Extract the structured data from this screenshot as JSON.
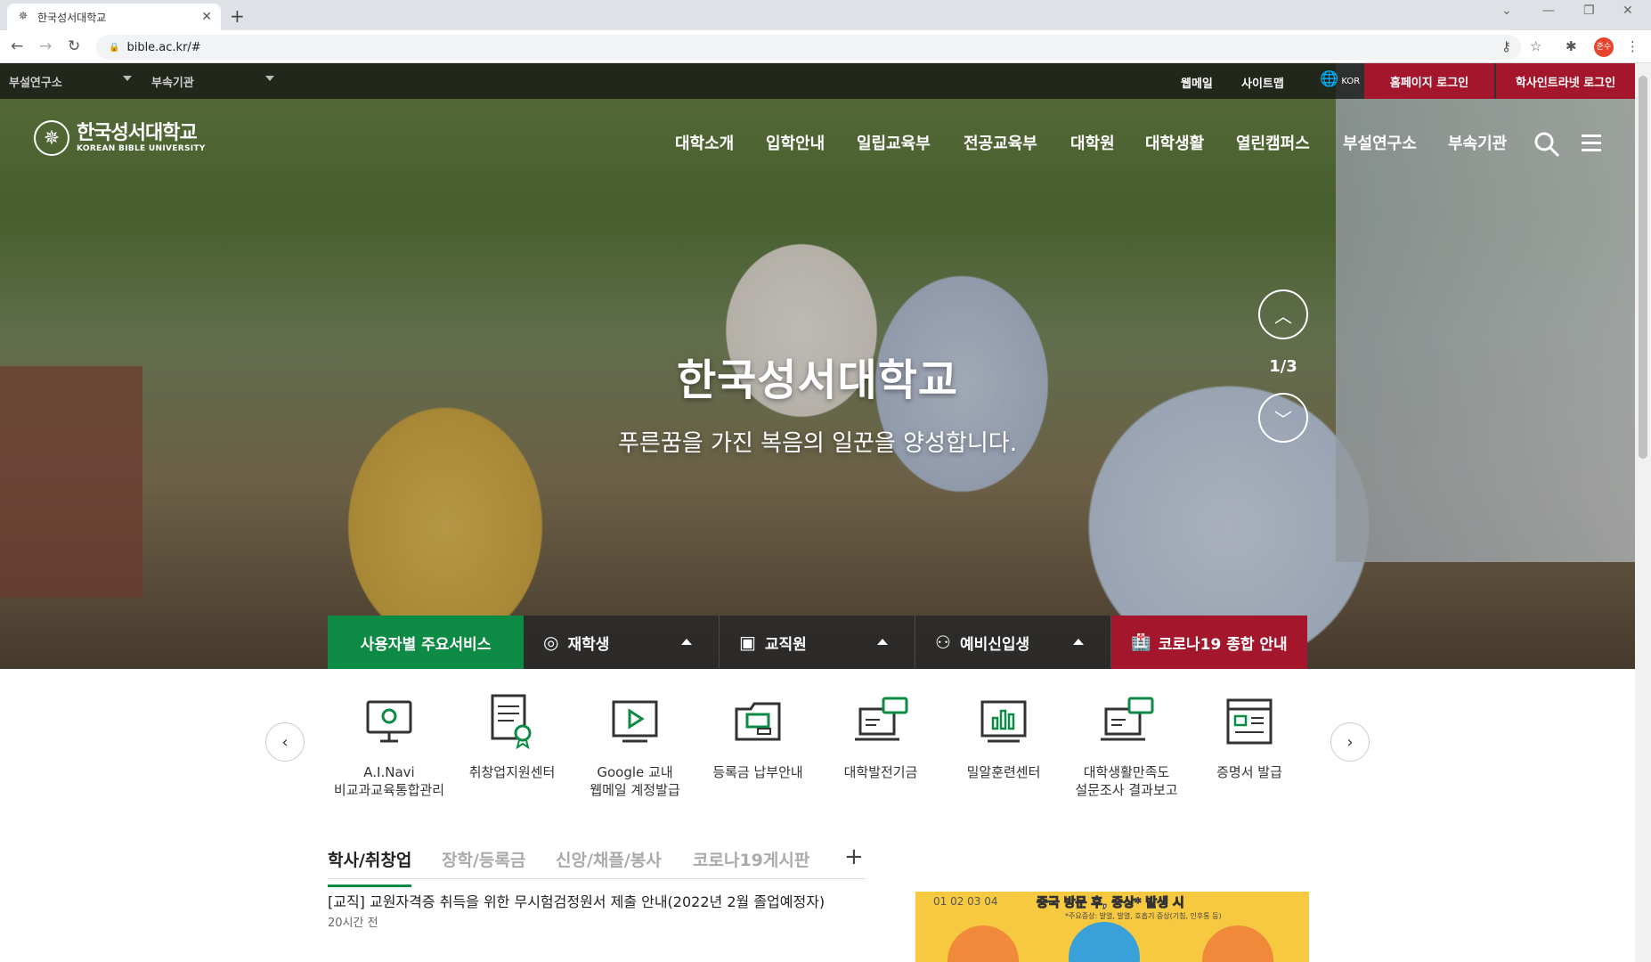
{
  "browser": {
    "tab_title": "한국성서대학교",
    "url": "bible.ac.kr/#",
    "profile_label": "준수"
  },
  "util": {
    "dropdowns": [
      "부설연구소",
      "부속기관"
    ],
    "links": [
      "웹메일",
      "사이트맵"
    ],
    "lang": "KOR",
    "login_home": "홈페이지 로그인",
    "login_intranet": "학사인트라넷 로그인"
  },
  "logo": {
    "ko": "한국성서대학교",
    "en": "KOREAN BIBLE UNIVERSITY"
  },
  "gnb": [
    "대학소개",
    "입학안내",
    "일립교육부",
    "전공교육부",
    "대학원",
    "대학생활",
    "열린캠퍼스",
    "부설연구소",
    "부속기관"
  ],
  "hero": {
    "title": "한국성서대학교",
    "subtitle": "푸른꿈을 가진 복음의 일꾼을 양성합니다.",
    "slide_counter": "1/3"
  },
  "services": {
    "head": "사용자별 주요서비스",
    "student": "재학생",
    "staff": "교직원",
    "freshman": "예비신입생",
    "covid": "코로나19 종합 안내"
  },
  "quicklinks": [
    {
      "label": "A.I.Navi\n비교과교육통합관리",
      "icon": "monitor-gear-icon"
    },
    {
      "label": "취창업지원센터",
      "icon": "certificate-icon"
    },
    {
      "label": "Google 교내\n웹메일 계정발급",
      "icon": "video-screen-icon"
    },
    {
      "label": "등록금 납부안내",
      "icon": "folder-icon"
    },
    {
      "label": "대학발전기금",
      "icon": "laptop-chat-icon"
    },
    {
      "label": "밀알훈련센터",
      "icon": "chart-monitor-icon"
    },
    {
      "label": "대학생활만족도\n설문조사 결과보고",
      "icon": "laptop-chat-icon"
    },
    {
      "label": "증명서 발급",
      "icon": "document-icon"
    }
  ],
  "news": {
    "tabs": [
      "학사/취창업",
      "장학/등록금",
      "신앙/채플/봉사",
      "코로나19게시판"
    ],
    "items": [
      {
        "title": "[교직] 교원자격증 취득을 위한 무시험검정원서 제출 안내(2022년 2월 졸업예정자)",
        "time": "20시간 전"
      }
    ]
  },
  "banner": {
    "nums": "01   02   03   04",
    "title": "중국 방문 후, 증상* 발생 시",
    "subtitle": "*주요증상: 발열, 발열, 호흡기 증상(기침, 인후통 등)"
  }
}
